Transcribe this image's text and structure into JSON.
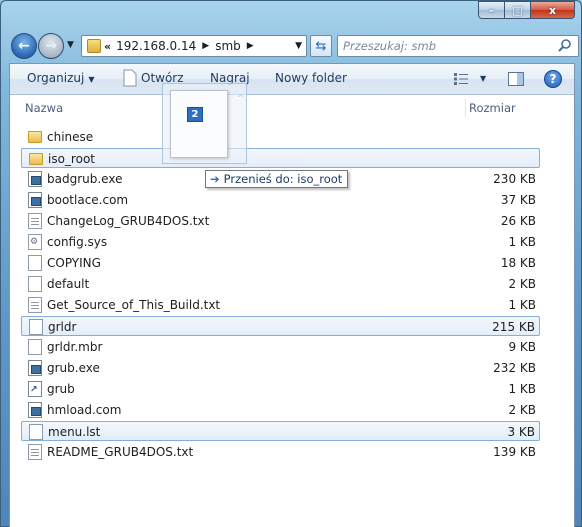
{
  "window": {
    "caption_buttons": {
      "minimize": "–",
      "maximize": "□",
      "close": "x"
    }
  },
  "nav": {
    "back_icon": "back-arrow",
    "forward_icon": "forward-arrow",
    "breadcrumb": {
      "overflow": "«",
      "items": [
        "192.168.0.14",
        "smb"
      ]
    },
    "search_placeholder": "Przeszukaj: smb"
  },
  "toolbar": {
    "organize": "Organizuj",
    "open": "Otwórz",
    "burn": "Nagraj",
    "new_folder": "Nowy folder"
  },
  "columns": {
    "name": "Nazwa",
    "size": "Rozmiar"
  },
  "files": [
    {
      "name": "chinese",
      "size": "",
      "type": "folder"
    },
    {
      "name": "iso_root",
      "size": "",
      "type": "folder",
      "selected": true
    },
    {
      "name": "badgrub.exe",
      "size": "230 KB",
      "type": "exe"
    },
    {
      "name": "bootlace.com",
      "size": "37 KB",
      "type": "exe"
    },
    {
      "name": "ChangeLog_GRUB4DOS.txt",
      "size": "26 KB",
      "type": "txt"
    },
    {
      "name": "config.sys",
      "size": "1 KB",
      "type": "sys"
    },
    {
      "name": "COPYING",
      "size": "18 KB",
      "type": "doc"
    },
    {
      "name": "default",
      "size": "2 KB",
      "type": "doc"
    },
    {
      "name": "Get_Source_of_This_Build.txt",
      "size": "1 KB",
      "type": "txt"
    },
    {
      "name": "grldr",
      "size": "215 KB",
      "type": "doc",
      "selected": true
    },
    {
      "name": "grldr.mbr",
      "size": "9 KB",
      "type": "doc"
    },
    {
      "name": "grub.exe",
      "size": "232 KB",
      "type": "exe"
    },
    {
      "name": "grub",
      "size": "1 KB",
      "type": "lnk"
    },
    {
      "name": "hmload.com",
      "size": "2 KB",
      "type": "exe"
    },
    {
      "name": "menu.lst",
      "size": "3 KB",
      "type": "doc",
      "selected": true
    },
    {
      "name": "README_GRUB4DOS.txt",
      "size": "139 KB",
      "type": "txt"
    }
  ],
  "drag": {
    "count": "2",
    "tooltip": "Przenieś do: iso_root"
  }
}
